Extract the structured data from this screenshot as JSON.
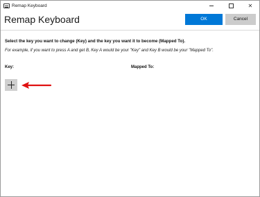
{
  "window": {
    "title": "Remap Keyboard"
  },
  "header": {
    "title": "Remap Keyboard",
    "ok_label": "OK",
    "cancel_label": "Cancel"
  },
  "content": {
    "instruction": "Select the key you want to change (Key) and the key you want it to become (Mapped To).",
    "example": "For example, if you want to press A and get B, Key A would be your \"Key\" and Key B would be your \"Mapped To\".",
    "col_key": "Key:",
    "col_mapped": "Mapped To:"
  },
  "colors": {
    "accent": "#0078d7",
    "annotation_arrow": "#e01010"
  },
  "icons": {
    "add": "plus-icon",
    "annotation": "red-arrow-icon"
  }
}
